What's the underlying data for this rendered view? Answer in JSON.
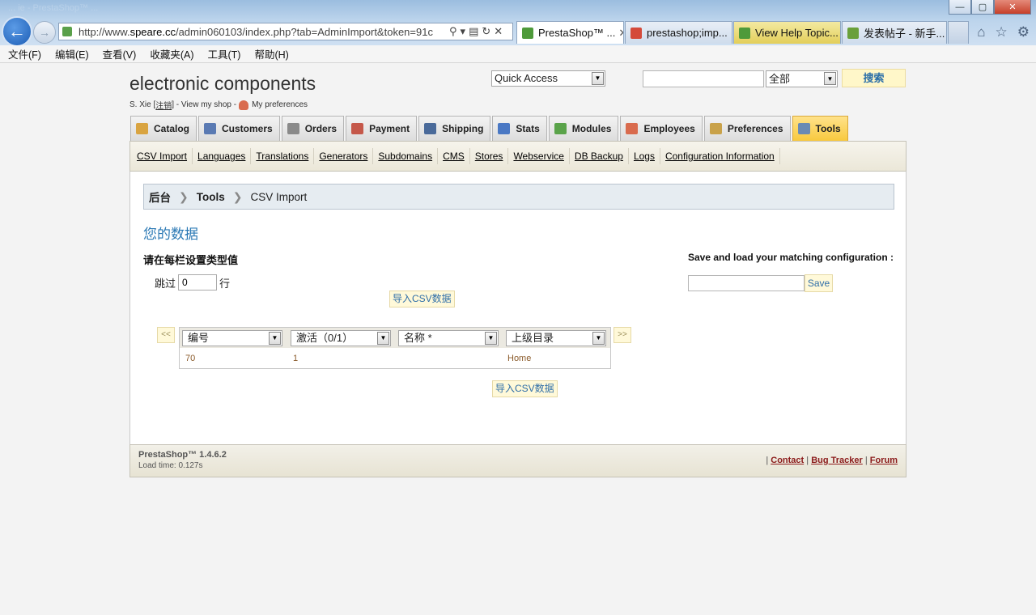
{
  "browser": {
    "window_title": "... ie - PrestaShop™ ...",
    "address_url_prefix": "http://www.",
    "address_url_host": "speare.cc",
    "address_url_rest": "/admin060103/index.php?tab=AdminImport&token=91c",
    "tabs": [
      {
        "label": "PrestaShop™ ...",
        "icon_color": "#4e9a3a",
        "style": "active"
      },
      {
        "label": "prestashop;imp...",
        "icon_color": "#d44a3a",
        "style": "yellow"
      },
      {
        "label": "View Help Topic...",
        "icon_color": "#4e9a3a",
        "style": "yellow"
      },
      {
        "label": "发表帖子 - 新手...",
        "icon_color": "#6aa03a",
        "style": "normal"
      }
    ],
    "window_buttons": [
      "—",
      "▢",
      "✕"
    ]
  },
  "menubar": [
    "文件(F)",
    "编辑(E)",
    "查看(V)",
    "收藏夹(A)",
    "工具(T)",
    "帮助(H)"
  ],
  "header": {
    "shop_name": "electronic components",
    "user_prefix": "S. Xie [",
    "logout": "注销",
    "user_suffix": "] - View my shop -",
    "preferences": "My preferences",
    "quick_access": "Quick Access",
    "search_scope": "全部",
    "search_button": "搜索"
  },
  "main_tabs": [
    {
      "label": "Catalog",
      "color": "#d9a441"
    },
    {
      "label": "Customers",
      "color": "#5a7ab3"
    },
    {
      "label": "Orders",
      "color": "#8a8a8a"
    },
    {
      "label": "Payment",
      "color": "#c5584a"
    },
    {
      "label": "Shipping",
      "color": "#4a6a9a"
    },
    {
      "label": "Stats",
      "color": "#4a78c4"
    },
    {
      "label": "Modules",
      "color": "#5aa34a"
    },
    {
      "label": "Employees",
      "color": "#d96b4e"
    },
    {
      "label": "Preferences",
      "color": "#c9a24a"
    },
    {
      "label": "Tools",
      "color": "#6a8ab4"
    }
  ],
  "active_tab": "Tools",
  "sub_nav": [
    "CSV Import",
    "Languages",
    "Translations",
    "Generators",
    "Subdomains",
    "CMS",
    "Stores",
    "Webservice",
    "DB Backup",
    "Logs",
    "Configuration Information"
  ],
  "breadcrumb": {
    "root": "后台",
    "section": "Tools",
    "page": "CSV Import"
  },
  "content": {
    "section_title": "您的数据",
    "set_type_label": "请在每栏设置类型值",
    "skip_prefix": "跳过",
    "skip_value": "0",
    "skip_suffix": "行",
    "import_button": "导入CSV数据",
    "save_config_label": "Save and load your matching configuration :",
    "save_button": "Save",
    "prev": "<<",
    "next": ">>",
    "columns": [
      "编号",
      "激活（0/1）",
      "名称 *",
      "上级目录"
    ],
    "row": [
      "70",
      "1",
      "",
      "Home"
    ]
  },
  "footer": {
    "version": "PrestaShop™ 1.4.6.2",
    "load_time": "Load time: 0.127s",
    "links": [
      "Contact",
      "Bug Tracker",
      "Forum"
    ]
  }
}
